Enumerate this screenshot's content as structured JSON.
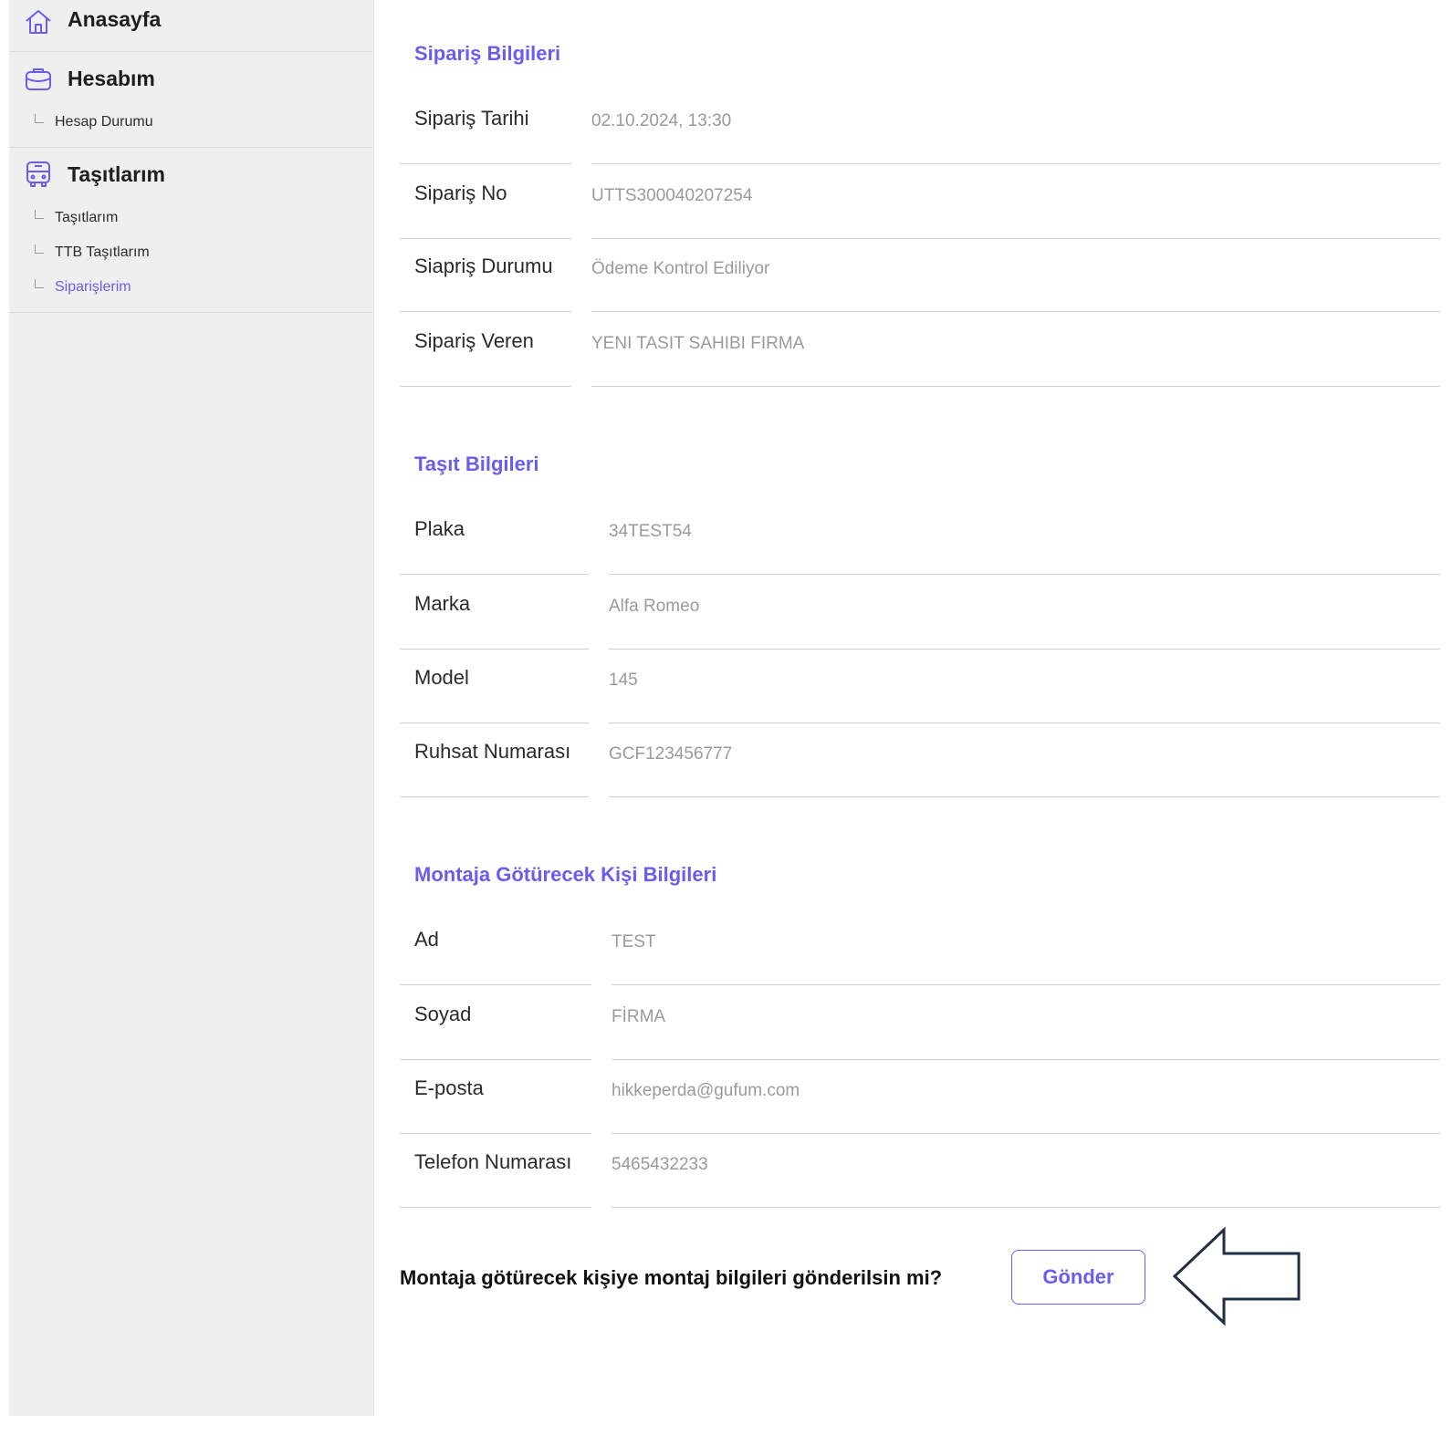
{
  "sidebar": {
    "groups": [
      {
        "label": "Anasayfa",
        "icon": "home-icon",
        "items": []
      },
      {
        "label": "Hesabım",
        "icon": "briefcase-icon",
        "items": [
          {
            "label": "Hesap Durumu",
            "active": false
          }
        ]
      },
      {
        "label": "Taşıtlarım",
        "icon": "bus-icon",
        "items": [
          {
            "label": "Taşıtlarım",
            "active": false
          },
          {
            "label": "TTB Taşıtlarım",
            "active": false
          },
          {
            "label": "Siparişlerim",
            "active": true
          }
        ]
      }
    ]
  },
  "order": {
    "title": "Sipariş Bilgileri",
    "fields": [
      {
        "label": "Sipariş Tarihi",
        "value": "02.10.2024, 13:30"
      },
      {
        "label": "Sipariş No",
        "value": "UTTS300040207254"
      },
      {
        "label": "Siapriş Durumu",
        "value": "Ödeme Kontrol Ediliyor"
      },
      {
        "label": "Sipariş Veren",
        "value": "YENI TASIT SAHIBI FIRMA"
      }
    ]
  },
  "vehicle": {
    "title": "Taşıt Bilgileri",
    "fields": [
      {
        "label": "Plaka",
        "value": "34TEST54"
      },
      {
        "label": "Marka",
        "value": "Alfa Romeo"
      },
      {
        "label": "Model",
        "value": "145"
      },
      {
        "label": "Ruhsat Numarası",
        "value": "GCF123456777"
      }
    ]
  },
  "person": {
    "title": "Montaja Götürecek Kişi Bilgileri",
    "fields": [
      {
        "label": "Ad",
        "value": "TEST"
      },
      {
        "label": "Soyad",
        "value": "FİRMA"
      },
      {
        "label": "E-posta",
        "value": "hikkeperda@gufum.com"
      },
      {
        "label": "Telefon Numarası",
        "value": "5465432233"
      }
    ]
  },
  "confirm": {
    "question": "Montaja götürecek kişiye montaj bilgileri gönderilsin mi?",
    "button_label": "Gönder"
  },
  "colors": {
    "accent": "#6a5cf0",
    "sidebar_bg": "#efefef",
    "arrow_stroke": "#1f2f44"
  }
}
